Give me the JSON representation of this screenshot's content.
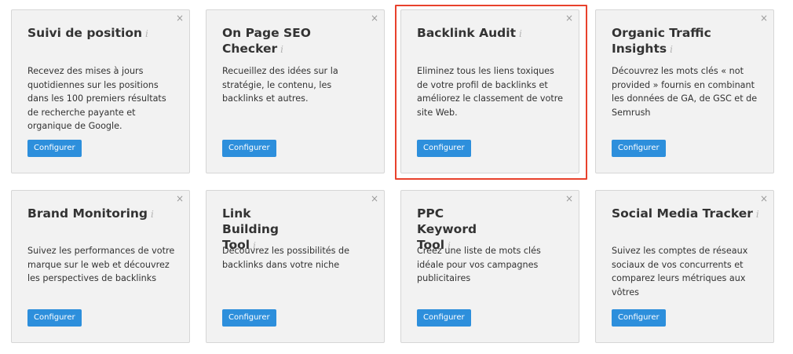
{
  "colors": {
    "highlight": "#e8412c",
    "button": "#2d8fdc",
    "card_bg": "#f2f2f2"
  },
  "info_glyph": "i",
  "close_glyph": "×",
  "cards": [
    {
      "title": "Suivi de position",
      "desc": "Recevez des mises à jours quotidiennes sur les positions dans les 100 premiers résultats de recherche payante et organique de Google.",
      "button": "Configurer"
    },
    {
      "title": "On Page SEO Checker",
      "desc": "Recueillez des idées sur la stratégie, le contenu, les backlinks et autres.",
      "button": "Configurer"
    },
    {
      "title": "Backlink Audit",
      "desc": "Eliminez tous les liens toxiques de votre profil de backlinks et améliorez le classement de votre site Web.",
      "button": "Configurer",
      "highlighted": true
    },
    {
      "title": "Organic Traffic Insights",
      "desc": "Découvrez les mots clés « not provided » fournis en combinant les données de GA, de GSC et de Semrush",
      "button": "Configurer"
    },
    {
      "title": "Brand Monitoring",
      "desc": "Suivez les performances de votre marque sur le web et découvrez les perspectives de backlinks",
      "button": "Configurer"
    },
    {
      "title": "Link Building Tool",
      "desc": "Découvrez les possibilités de backlinks dans votre niche",
      "button": "Configurer"
    },
    {
      "title": "PPC Keyword Tool",
      "desc": "Créez une liste de mots clés idéale pour vos campagnes publicitaires",
      "button": "Configurer"
    },
    {
      "title": "Social Media Tracker",
      "desc": "Suivez les comptes de réseaux sociaux de vos concurrents et comparez leurs métriques aux vôtres",
      "button": "Configurer"
    }
  ]
}
